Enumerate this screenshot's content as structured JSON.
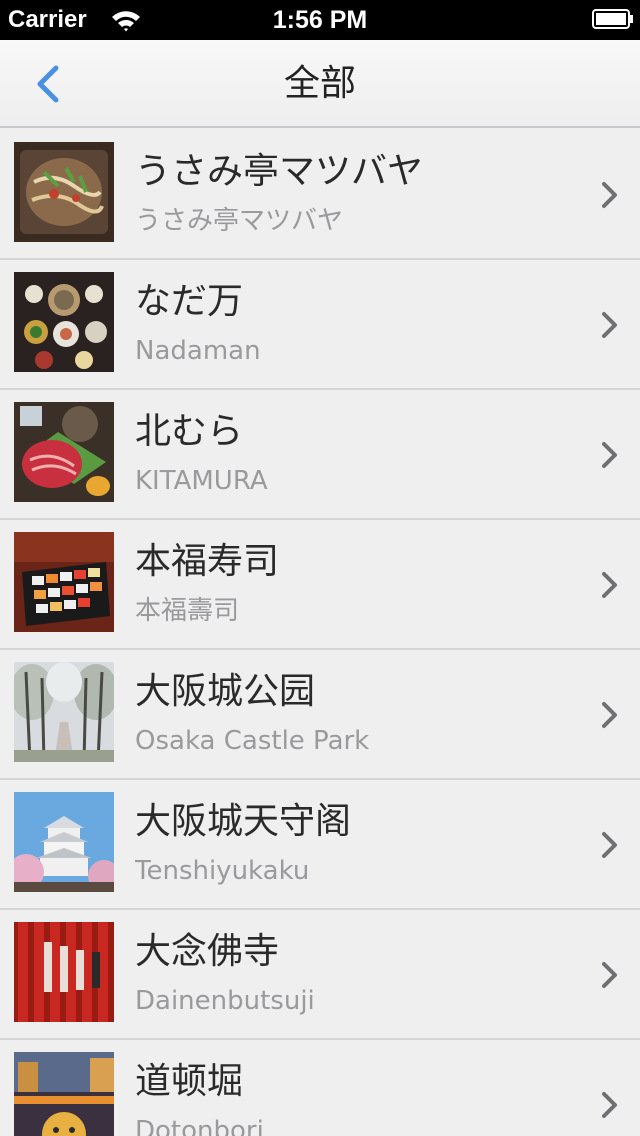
{
  "status_bar": {
    "carrier": "Carrier",
    "time": "1:56 PM"
  },
  "nav": {
    "title": "全部",
    "back_icon": "chevron-left-icon",
    "accent_color": "#4a90e2"
  },
  "list": {
    "items": [
      {
        "title": "うさみ亭マツバヤ",
        "subtitle": "うさみ亭マツバヤ"
      },
      {
        "title": "なだ万",
        "subtitle": "Nadaman"
      },
      {
        "title": "北むら",
        "subtitle": "KITAMURA"
      },
      {
        "title": "本福寿司",
        "subtitle": "本福壽司"
      },
      {
        "title": "大阪城公园",
        "subtitle": "Osaka Castle Park"
      },
      {
        "title": "大阪城天守阁",
        "subtitle": "Tenshiyukaku"
      },
      {
        "title": "大念佛寺",
        "subtitle": "Dainenbutsuji"
      },
      {
        "title": "道顿堀",
        "subtitle": "Dotonbori"
      }
    ]
  }
}
